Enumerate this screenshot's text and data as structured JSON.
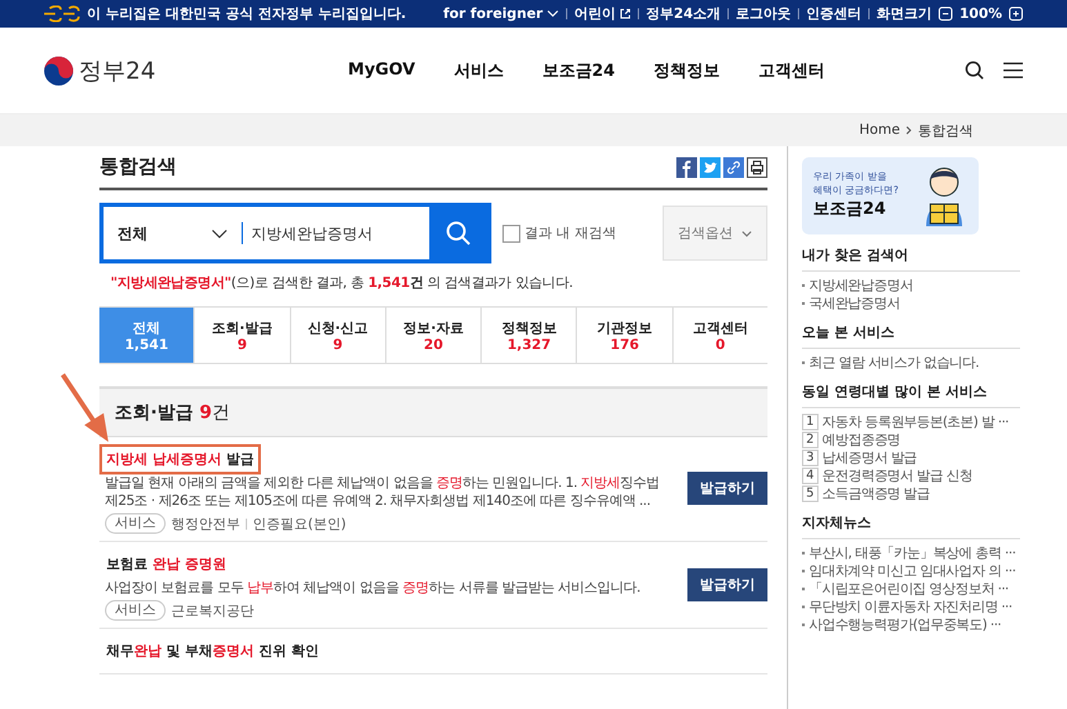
{
  "top_bar": {
    "notice": "이 누리집은 대한민국 공식 전자정부 누리집입니다.",
    "links": [
      {
        "label": "for foreigner",
        "kind": "dropdown"
      },
      {
        "label": "어린이",
        "kind": "external"
      },
      {
        "label": "정부24소개",
        "kind": "plain"
      },
      {
        "label": "로그아웃",
        "kind": "plain"
      },
      {
        "label": "인증센터",
        "kind": "plain"
      }
    ],
    "zoom": {
      "label": "화면크기",
      "value": "100%"
    }
  },
  "header": {
    "logo": "정부24",
    "nav": [
      "MyGOV",
      "서비스",
      "보조금24",
      "정책정보",
      "고객센터"
    ]
  },
  "breadcrumb": [
    "Home",
    "통합검색"
  ],
  "page_title": "통합검색",
  "search": {
    "scope": "전체",
    "value": "지방세완납증명서",
    "within_results": {
      "label": "결과 내 재검색",
      "checked": false
    },
    "options_button": "검색옵션"
  },
  "summary": {
    "query": "\"지방세완납증명서\"",
    "middle": "(으)로 검색한 결과, 총 ",
    "count": "1,541",
    "unit": "건",
    "tail": " 의 검색결과가 있습니다."
  },
  "tabs": [
    {
      "label": "전체",
      "count": "1,541",
      "selected": true
    },
    {
      "label": "조회·발급",
      "count": "9",
      "selected": false
    },
    {
      "label": "신청·신고",
      "count": "9",
      "selected": false
    },
    {
      "label": "정보·자료",
      "count": "20",
      "selected": false
    },
    {
      "label": "정책정보",
      "count": "1,327",
      "selected": false
    },
    {
      "label": "기관정보",
      "count": "176",
      "selected": false
    },
    {
      "label": "고객센터",
      "count": "0",
      "selected": false
    }
  ],
  "section": {
    "title": "조회·발급",
    "count": "9",
    "unit": "건"
  },
  "results": [
    {
      "title": [
        {
          "text": "지방세 납세증명서",
          "highlight": true
        },
        {
          "text": " 발급",
          "highlight": false
        }
      ],
      "annotated": true,
      "description": [
        {
          "text": "발급일 현재 아래의 금액을 제외한 다른 체납액이 없음을 ",
          "highlight": false
        },
        {
          "text": "증명",
          "highlight": true
        },
        {
          "text": "하는 민원입니다. 1. ",
          "highlight": false
        },
        {
          "text": "지방세",
          "highlight": true
        },
        {
          "text": "징수법 제25조 · 제26조 또는 제105조에 따른 유예액 2. 채무자회생법 제140조에 따른 징수유예액 ...",
          "highlight": false
        }
      ],
      "tag": "서비스",
      "meta": [
        "행정안전부",
        "인증필요(본인)"
      ],
      "button": "발급하기"
    },
    {
      "title": [
        {
          "text": "보험료 ",
          "highlight": false
        },
        {
          "text": "완납 증명원",
          "highlight": true
        }
      ],
      "annotated": false,
      "description": [
        {
          "text": "사업장이 보험료를 모두 ",
          "highlight": false
        },
        {
          "text": "납부",
          "highlight": true
        },
        {
          "text": "하여 체납액이 없음을 ",
          "highlight": false
        },
        {
          "text": "증명",
          "highlight": true
        },
        {
          "text": "하는 서류를 발급받는 서비스입니다.",
          "highlight": false
        }
      ],
      "tag": "서비스",
      "meta": [
        "근로복지공단"
      ],
      "button": "발급하기"
    },
    {
      "title": [
        {
          "text": "채무",
          "highlight": false
        },
        {
          "text": "완납",
          "highlight": true
        },
        {
          "text": " 및 부채",
          "highlight": false
        },
        {
          "text": "증명서",
          "highlight": true
        },
        {
          "text": " 진위 확인",
          "highlight": false
        }
      ],
      "annotated": false
    }
  ],
  "banner": {
    "line1": "우리 가족이 받을",
    "line2": "혜택이 궁금하다면?",
    "brand": "보조금24"
  },
  "sidebar": [
    {
      "title": "내가 찾은 검색어",
      "kind": "bullet",
      "items": [
        {
          "text": "지방세완납증명서"
        },
        {
          "text": "국세완납증명서"
        }
      ]
    },
    {
      "title": "오늘 본 서비스",
      "kind": "bullet",
      "items": [
        {
          "text": "최근 열람 서비스가 없습니다."
        }
      ]
    },
    {
      "title": "동일 연령대별 많이 본 서비스",
      "kind": "numbered",
      "items": [
        {
          "number": "1",
          "text": "자동차 등록원부등본(초본) 발 ···"
        },
        {
          "number": "2",
          "text": "예방접종증명"
        },
        {
          "number": "3",
          "text": "납세증명서 발급"
        },
        {
          "number": "4",
          "text": "운전경력증명서 발급 신청"
        },
        {
          "number": "5",
          "text": "소득금액증명 발급"
        }
      ]
    },
    {
      "title": "지자체뉴스",
      "kind": "bullet",
      "items": [
        {
          "text": "부산시, 태풍「카눈」복상에 총력 ···"
        },
        {
          "text": "임대차계약 미신고 임대사업자 의 ···"
        },
        {
          "text": "「시립포은어린이집 영상정보처 ···"
        },
        {
          "text": "무단방치 이륜자동차 자진처리명 ···"
        },
        {
          "text": "사업수행능력평가(업무중복도) ···"
        }
      ]
    }
  ]
}
